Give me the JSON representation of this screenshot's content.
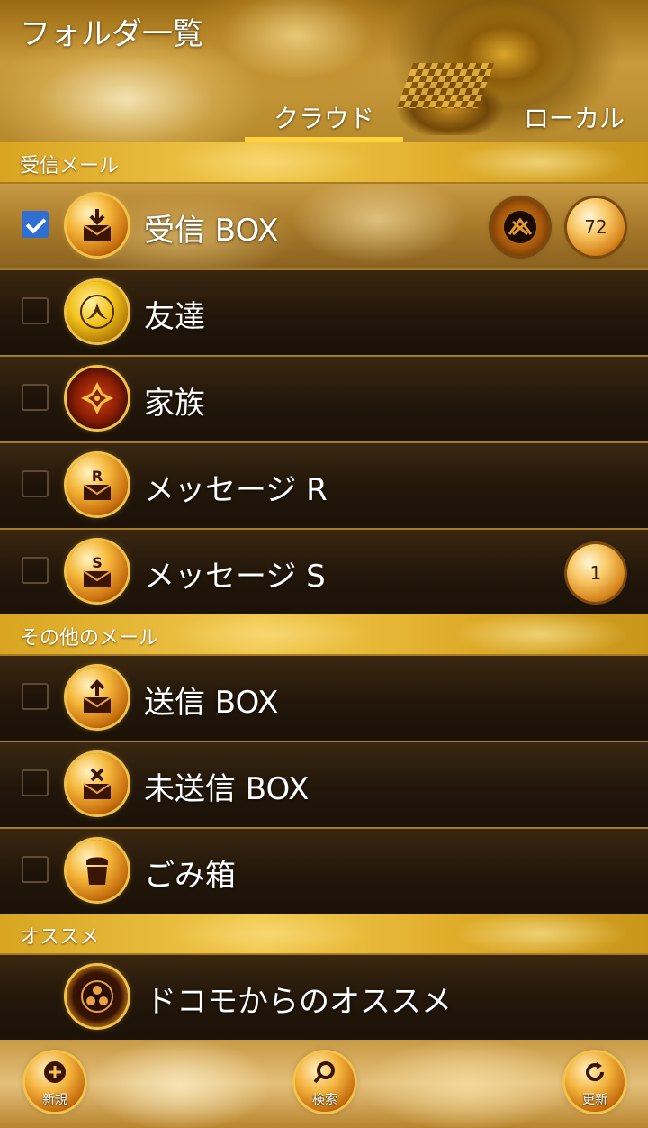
{
  "header": {
    "title": "フォルダ一覧",
    "tabs": [
      {
        "label": "クラウド",
        "selected": true
      },
      {
        "label": "ローカル",
        "selected": false
      }
    ]
  },
  "sections": [
    {
      "title": "受信メール",
      "items": [
        {
          "label": "受信 BOX",
          "checked": true,
          "icon": "inbox-download-icon",
          "badge": "72",
          "has_mark": true
        },
        {
          "label": "友達",
          "checked": false,
          "icon": "phoenix-crest-icon"
        },
        {
          "label": "家族",
          "checked": false,
          "icon": "diamond-crest-icon"
        },
        {
          "label": "メッセージ R",
          "checked": false,
          "icon": "mail-r-icon"
        },
        {
          "label": "メッセージ S",
          "checked": false,
          "icon": "mail-s-icon",
          "badge": "1"
        }
      ]
    },
    {
      "title": "その他のメール",
      "items": [
        {
          "label": "送信 BOX",
          "checked": false,
          "icon": "outbox-upload-icon"
        },
        {
          "label": "未送信 BOX",
          "checked": false,
          "icon": "mail-unsent-icon"
        },
        {
          "label": "ごみ箱",
          "checked": false,
          "icon": "trash-icon"
        }
      ]
    },
    {
      "title": "オススメ",
      "items": [
        {
          "label": "ドコモからのオススメ",
          "icon": "tomoe-crest-icon"
        }
      ]
    }
  ],
  "footer": {
    "new_label": "新規",
    "search_label": "検索",
    "refresh_label": "更新"
  },
  "colors": {
    "accent": "#ffd23e",
    "checkbox_checked": "#2f6fd1",
    "row_dark": "#22160a",
    "section_gold": "#e8b430"
  }
}
